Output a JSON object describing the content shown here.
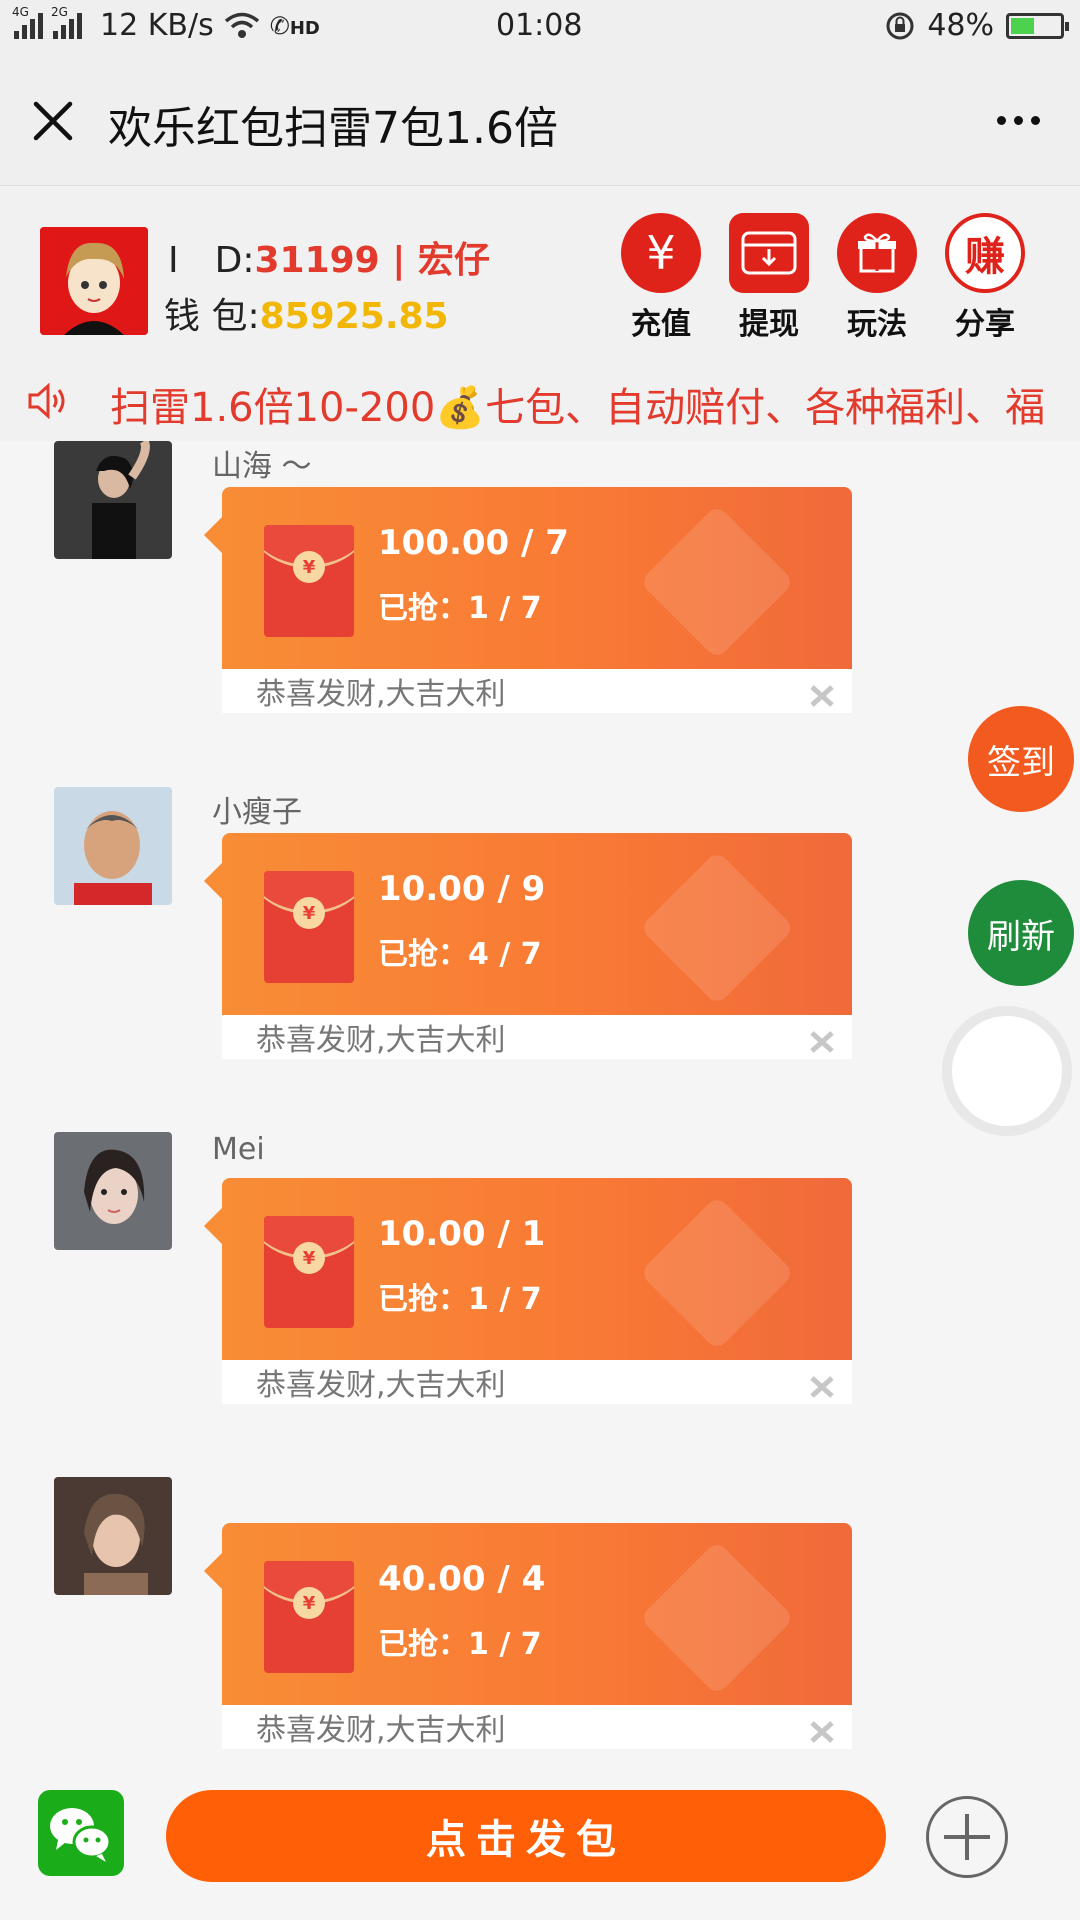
{
  "status_bar": {
    "network_1": "4G",
    "network_2": "2G",
    "speed": "12 KB/s",
    "hd": "HD",
    "time": "01:08",
    "battery": "48%",
    "battery_level": 0.48
  },
  "title_bar": {
    "title": "欢乐红包扫雷7包1.6倍"
  },
  "user": {
    "id_label": "I　D:",
    "id_value": "31199 | 宏仔",
    "wallet_label": "钱 包:",
    "wallet_value": "85925.85"
  },
  "actions": [
    {
      "label": "充值",
      "icon": "yen-icon",
      "glyph": "¥"
    },
    {
      "label": "提现",
      "icon": "withdraw-card-icon",
      "glyph": ""
    },
    {
      "label": "玩法",
      "icon": "gift-icon",
      "glyph": ""
    },
    {
      "label": "分享",
      "icon": "earn-icon",
      "glyph": "赚"
    }
  ],
  "marquee": {
    "text": "扫雷1.6倍10-200💰七包、自动赔付、各种福利、福"
  },
  "messages": [
    {
      "name": "山海 ～",
      "amount": "100.00 / 7",
      "grabbed": "已抢：1 / 7",
      "blessing": "恭喜发财,大吉大利"
    },
    {
      "name": "小瘦子",
      "amount": "10.00 / 9",
      "grabbed": "已抢：4 / 7",
      "blessing": "恭喜发财,大吉大利"
    },
    {
      "name": "Mei",
      "amount": "10.00 / 1",
      "grabbed": "已抢：1 / 7",
      "blessing": "恭喜发财,大吉大利"
    },
    {
      "name": "",
      "amount": "40.00 / 4",
      "grabbed": "已抢：1 / 7",
      "blessing": "恭喜发财,大吉大利"
    }
  ],
  "floating": {
    "sign_in": "签到",
    "refresh": "刷新"
  },
  "bottom": {
    "send_label": "点击发包"
  },
  "colors": {
    "accent_red": "#e23a2c",
    "wallet_gold": "#f2b705",
    "button_orange": "#ff5f06",
    "refresh_green": "#1e8c3a"
  }
}
